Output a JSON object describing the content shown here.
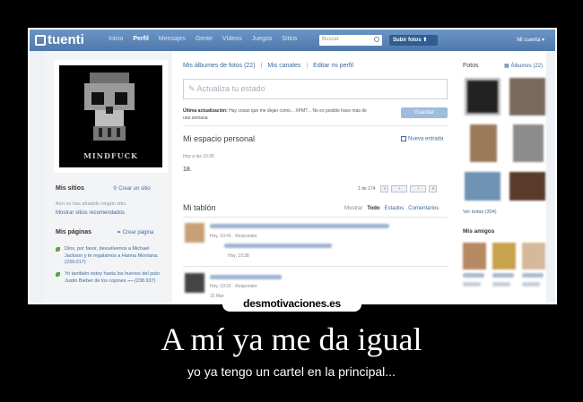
{
  "topbar": {
    "logo_text": "tuenti",
    "nav": [
      "Inicio",
      "Perfil",
      "Mensajes",
      "Gente",
      "Vídeos",
      "Juegos",
      "Sitios"
    ],
    "active_nav": "Perfil",
    "search_placeholder": "Buscar",
    "upload_label": "Subir fotos",
    "account_label": "Mi cuenta"
  },
  "profile": {
    "avatar_caption": "MINDFUCK",
    "sites_title": "Mis sitios",
    "create_site": "Crear un sitio",
    "sites_empty": "Aún no has añadido ningún sitio.",
    "sites_recommended": "Mostrar sitios recomendados",
    "pages_title": "Mis páginas",
    "create_page": "Crear página",
    "pages": [
      "Dios, por favor, devuélvenos a Michael Jackson y te regalamos a Hanna Montana. (239.017)",
      "Yo también estoy hasta los huevos del puto Justin Bieber de los cojones ¬¬ (238.937)"
    ]
  },
  "main": {
    "tabs": [
      "Mis álbumes de fotos (22)",
      "Mis canales",
      "Editar mi perfil"
    ],
    "status_placeholder": "Actualiza tu estado",
    "last_update_label": "Última actualización:",
    "last_update_text": "Hay cosas que me dejan como... XPM?... No es posible hace más de una semana",
    "update_button": "Guardar",
    "personal_space_title": "Mi espacio personal",
    "new_entry": "Nueva entrada",
    "personal_space_meta": "Hoy a las 10:35",
    "personal_space_text": "18.",
    "pager_text": "1 de 174",
    "wall_title": "Mi tablón",
    "wall_filters_label": "Mostrar",
    "wall_filters": [
      "Todo",
      "Estados",
      "Comentarios"
    ],
    "wall_posts": [
      {
        "meta": "Hoy, 10:41",
        "reply": "Responder",
        "sub_meta": "Hoy, 10:38"
      },
      {
        "meta": "Hoy, 10:31",
        "reply": "Responder",
        "sub_meta": "15 Mar"
      }
    ]
  },
  "sidebar_right": {
    "photos_title": "Fotos",
    "albums_label": "Álbumes (22)",
    "see_all": "Ver todas (304)",
    "friends_title": "Mis amigos"
  },
  "watermark": "desmotivaciones.es",
  "poster": {
    "headline": "A mí ya me da igual",
    "subline": "yo ya tengo un cartel en la principal..."
  }
}
